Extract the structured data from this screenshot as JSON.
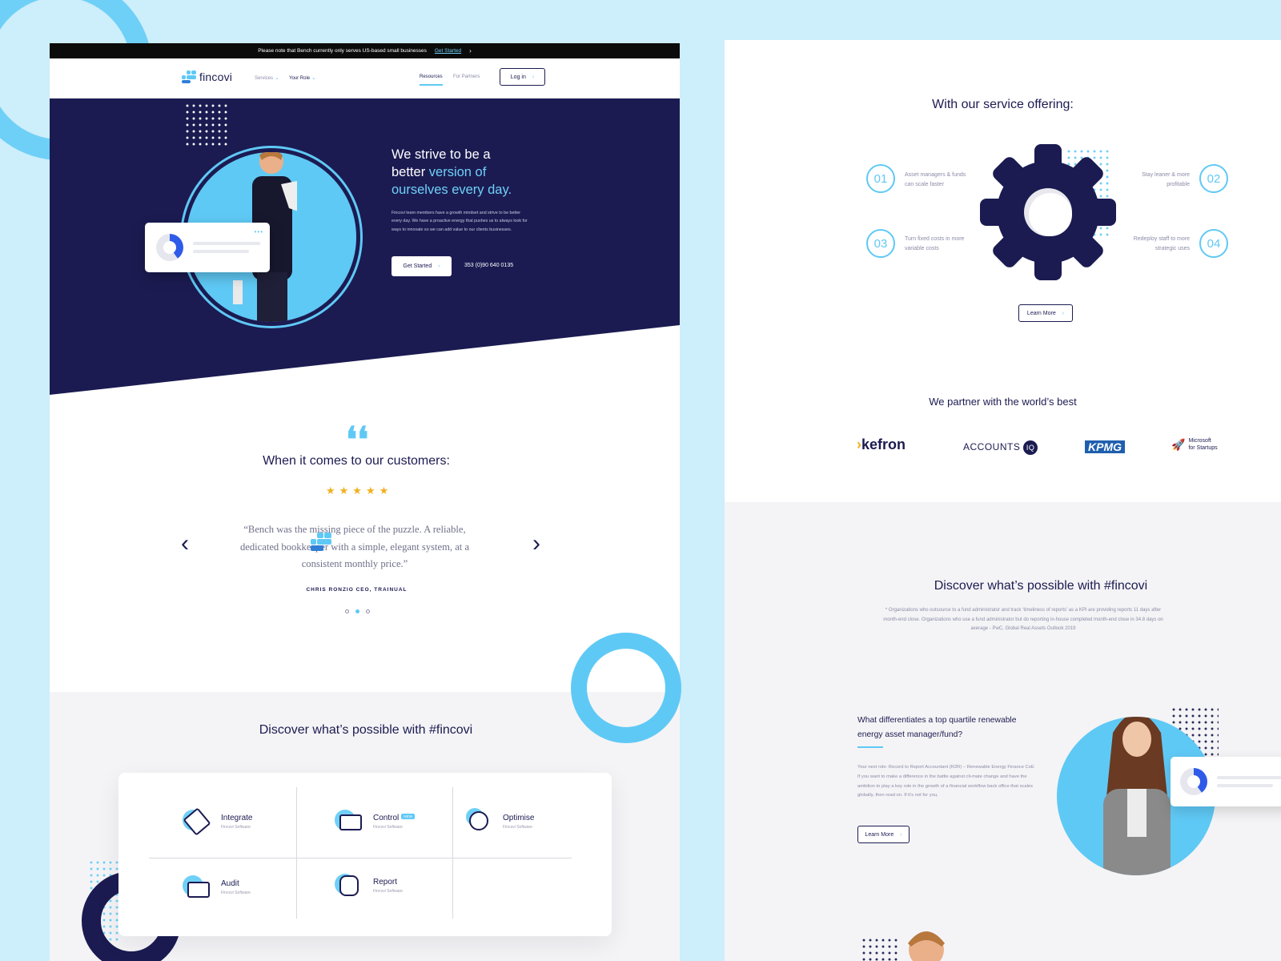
{
  "left_page": {
    "notice": {
      "text": "Please note that Bench currently only serves US-based small businesses",
      "link": "Get Started"
    },
    "nav": {
      "logo": "fincovi",
      "services": "Services",
      "your_role": "Your Role",
      "resources": "Resources",
      "for_partners": "For Partners",
      "login": "Log in"
    },
    "hero": {
      "title_line1": "We strive to be a",
      "title_line2a": "better ",
      "title_line2b": "version of",
      "title_line3": "ourselves every day.",
      "body": "Fincovi team members have a growth mindset and strive to be better every day. We have a proactive energy that pushes us to always look for ways to innovate so we can add value to our clients businesses.",
      "cta": "Get Started",
      "phone": "353 (0)90 640 0135"
    },
    "testimonial": {
      "heading": "When it comes to our customers:",
      "rating": 5,
      "stars": "★★★★★",
      "quote": "“Bench was the missing piece of the puzzle. A reliable, dedicated bookkeeper with a simple, elegant system, at a consistent monthly price.”",
      "author": "CHRIS RONZIO CEO, TRAINUAL",
      "slides": 3,
      "active_slide": 2
    },
    "discover": {
      "heading": "Discover what’s possible with #fincovi",
      "features": [
        {
          "name": "Integrate",
          "sub": "Fincovi Software"
        },
        {
          "name": "Control",
          "sub": "Fincovi Software",
          "badge": "NEW"
        },
        {
          "name": "Optimise",
          "sub": "Fincovi Software"
        },
        {
          "name": "Audit",
          "sub": "Fincovi Software"
        },
        {
          "name": "Report",
          "sub": "Fincovi Software"
        }
      ]
    }
  },
  "right_page": {
    "service_heading": "With our service offering:",
    "offerings": [
      {
        "num": "01",
        "text": "Asset managers & funds can scale faster"
      },
      {
        "num": "02",
        "text": "Stay leaner & more profitable"
      },
      {
        "num": "03",
        "text": "Turn fixed costs in more variable costs"
      },
      {
        "num": "04",
        "text": "Redeploy staff to more strategic uses"
      }
    ],
    "learn_more": "Learn More",
    "partners_heading": "We partner with the world’s best",
    "partners": [
      "kefron",
      "ACCOUNTS",
      "IQ",
      "KPMG",
      "Microsoft",
      "for Startups"
    ],
    "discover": {
      "heading": "Discover what’s possible with #fincovi",
      "footnote": "* Organizations who outsource to a fund administrator and track ‘timeliness of reports’ as a KPI are providing reports 11 days after month-end close. Organizations who use a fund administrator but do reporting in-house completed month-end close in 34.8 days on average - PwC, Global Real Assets Outlook 2019"
    },
    "job": {
      "title": "What differentiates a top quartile renewable energy asset manager/fund?",
      "body": "Your next role: Record to Report Accountant (R2R) – Renewable Energy Finance CoE If you want to make a difference in the battle against cli-mate change and have the ambition to play a key role in the growth of a financial workflow back office that scales globally, then read on. If it’s not for you,",
      "cta": "Learn More"
    }
  },
  "colors": {
    "navy": "#1b1b52",
    "accent": "#5fc9f5",
    "background": "#cdeefb",
    "star": "#f2b01e"
  }
}
